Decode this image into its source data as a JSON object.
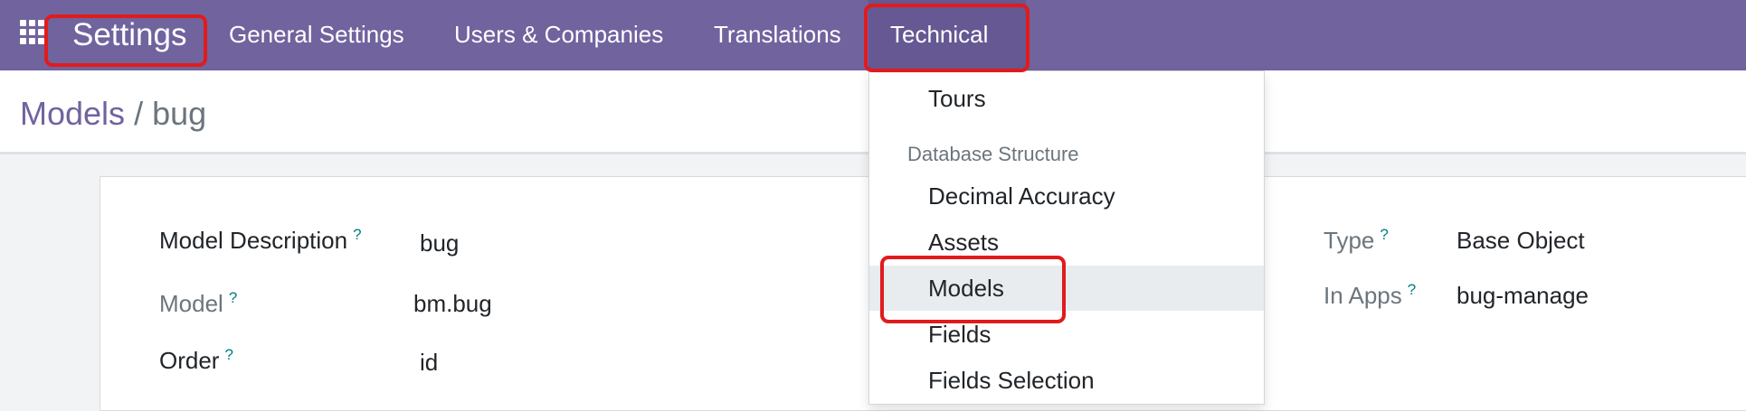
{
  "navbar": {
    "brand": "Settings",
    "items": [
      {
        "label": "General Settings"
      },
      {
        "label": "Users & Companies"
      },
      {
        "label": "Translations"
      },
      {
        "label": "Technical"
      }
    ]
  },
  "breadcrumb": {
    "parent": "Models",
    "separator": " / ",
    "current": "bug"
  },
  "form": {
    "model_description": {
      "label": "Model Description",
      "help": "?",
      "value": "bug"
    },
    "model": {
      "label": "Model",
      "help": "?",
      "value": "bm.bug"
    },
    "order": {
      "label": "Order",
      "help": "?",
      "value": "id"
    },
    "type": {
      "label": "Type",
      "help": "?",
      "value": "Base Object"
    },
    "in_apps": {
      "label": "In Apps",
      "help": "?",
      "value": "bug-manage"
    }
  },
  "technical_menu": {
    "items": [
      {
        "label": "Tours"
      },
      {
        "header": "Database Structure"
      },
      {
        "label": "Decimal Accuracy"
      },
      {
        "label": "Assets"
      },
      {
        "label": "Models",
        "hovered": true
      },
      {
        "label": "Fields"
      },
      {
        "label": "Fields Selection"
      }
    ]
  },
  "colors": {
    "navbar": "#71639e",
    "link": "#71639e",
    "highlight": "#e11b1b",
    "help": "#017e84"
  }
}
